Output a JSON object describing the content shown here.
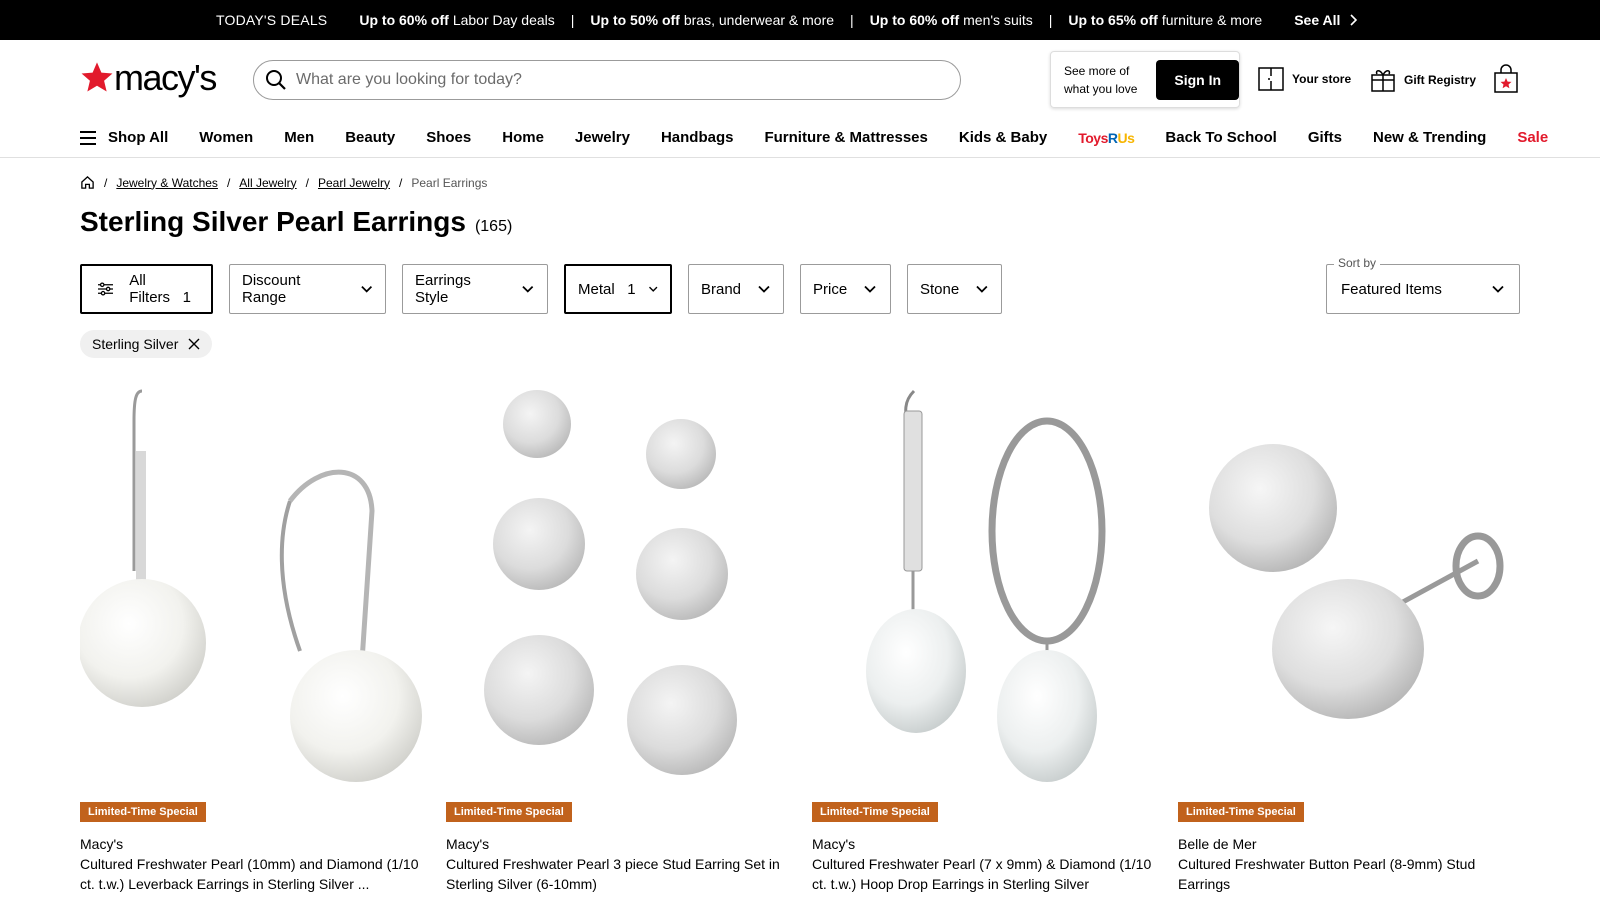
{
  "promo": {
    "today": "TODAY'S DEALS",
    "deals": [
      {
        "bold": "Up to 60% off",
        "text": "Labor Day deals"
      },
      {
        "bold": "Up to 50% off",
        "text": "bras, underwear & more"
      },
      {
        "bold": "Up to 60% off",
        "text": "men's suits"
      },
      {
        "bold": "Up to 65% off",
        "text": "furniture & more"
      }
    ],
    "see_all": "See All"
  },
  "header": {
    "logo_text": "macy's",
    "search_placeholder": "What are you looking for today?",
    "promo_card_text": "See more of what you love",
    "sign_in": "Sign In",
    "your_store": "Your store",
    "gift_registry": "Gift Registry"
  },
  "nav": {
    "shop_all": "Shop All",
    "items": [
      "Women",
      "Men",
      "Beauty",
      "Shoes",
      "Home",
      "Jewelry",
      "Handbags",
      "Furniture & Mattresses",
      "Kids & Baby"
    ],
    "toys": {
      "a": "Toys",
      "b": "R",
      "c": "Us"
    },
    "items2": [
      "Back To School",
      "Gifts",
      "New & Trending"
    ],
    "sale": "Sale"
  },
  "breadcrumb": {
    "items": [
      "Jewelry & Watches",
      "All Jewelry",
      "Pearl Jewelry"
    ],
    "current": "Pearl Earrings"
  },
  "page": {
    "title": "Sterling Silver Pearl Earrings",
    "count": "(165)"
  },
  "filters": {
    "all_filters": "All Filters",
    "all_filters_count": "1",
    "discount": "Discount Range",
    "style": "Earrings Style",
    "metal": "Metal",
    "metal_count": "1",
    "brand": "Brand",
    "price": "Price",
    "stone": "Stone",
    "sort_label": "Sort by",
    "sort_value": "Featured Items",
    "chip": "Sterling Silver"
  },
  "products": [
    {
      "badge": "Limited-Time Special",
      "brand": "Macy's",
      "name": "Cultured Freshwater Pearl (10mm) and Diamond (1/10 ct. t.w.) Leverback Earrings in Sterling Silver ..."
    },
    {
      "badge": "Limited-Time Special",
      "brand": "Macy's",
      "name": "Cultured Freshwater Pearl 3 piece Stud Earring Set in Sterling Silver (6-10mm)"
    },
    {
      "badge": "Limited-Time Special",
      "brand": "Macy's",
      "name": "Cultured Freshwater Pearl (7 x 9mm) & Diamond (1/10 ct. t.w.) Hoop Drop Earrings in Sterling Silver"
    },
    {
      "badge": "Limited-Time Special",
      "brand": "Belle de Mer",
      "name": "Cultured Freshwater Button Pearl (8-9mm) Stud Earrings"
    }
  ],
  "colors": {
    "brand_red": "#e21a2c",
    "badge": "#c1621c"
  }
}
